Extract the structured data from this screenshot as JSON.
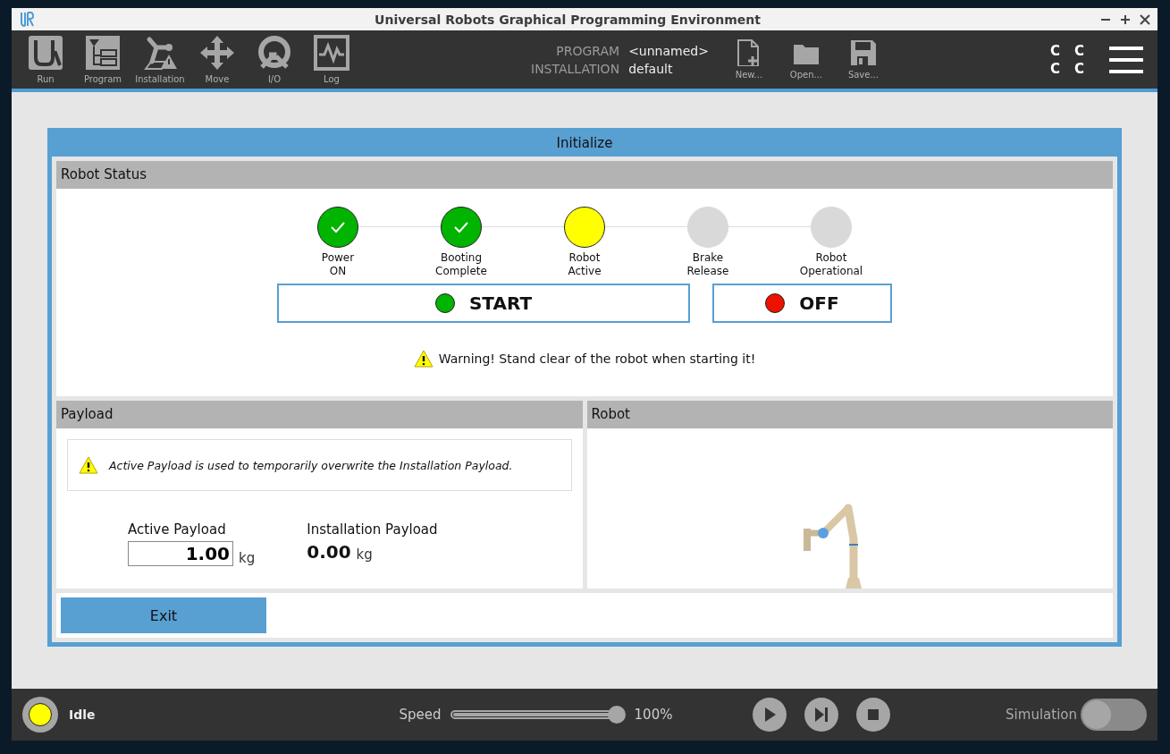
{
  "window": {
    "title": "Universal Robots Graphical Programming Environment"
  },
  "toolbar": {
    "nav": [
      {
        "label": "Run"
      },
      {
        "label": "Program"
      },
      {
        "label": "Installation"
      },
      {
        "label": "Move"
      },
      {
        "label": "I/O"
      },
      {
        "label": "Log"
      }
    ],
    "program": {
      "label": "PROGRAM",
      "value": "<unnamed>"
    },
    "installation": {
      "label": "INSTALLATION",
      "value": "default"
    },
    "files": [
      {
        "label": "New..."
      },
      {
        "label": "Open..."
      },
      {
        "label": "Save..."
      }
    ],
    "mode_letters": [
      "C",
      "C",
      "C",
      "C"
    ]
  },
  "dialog": {
    "title": "Initialize",
    "robot_status": {
      "title": "Robot Status",
      "steps": [
        {
          "label": "Power\nON",
          "complete": true,
          "active": false
        },
        {
          "label": "Booting\nComplete",
          "complete": true,
          "active": false
        },
        {
          "label": "Robot\nActive",
          "complete": false,
          "active": true
        },
        {
          "label": "Brake\nRelease",
          "complete": false,
          "active": false
        },
        {
          "label": "Robot\nOperational",
          "complete": false,
          "active": false
        }
      ],
      "start_button": {
        "label": "START",
        "color": "#00b400"
      },
      "off_button": {
        "label": "OFF",
        "color": "#ee1100"
      },
      "warning": "Warning! Stand clear of the robot when starting it!"
    },
    "payload": {
      "title": "Payload",
      "note": "Active Payload is used to temporarily overwrite the Installation Payload.",
      "active": {
        "label": "Active Payload",
        "value": "1.00",
        "unit": "kg"
      },
      "installation": {
        "label": "Installation Payload",
        "value": "0.00",
        "unit": "kg"
      }
    },
    "robot": {
      "title": "Robot"
    },
    "exit_button": "Exit"
  },
  "status_bar": {
    "state": {
      "label": "Idle",
      "color": "#ffff00"
    },
    "speed": {
      "label": "Speed",
      "level": 1.0,
      "reading": "100%"
    },
    "simulation": {
      "label": "Simulation",
      "on": false
    }
  }
}
